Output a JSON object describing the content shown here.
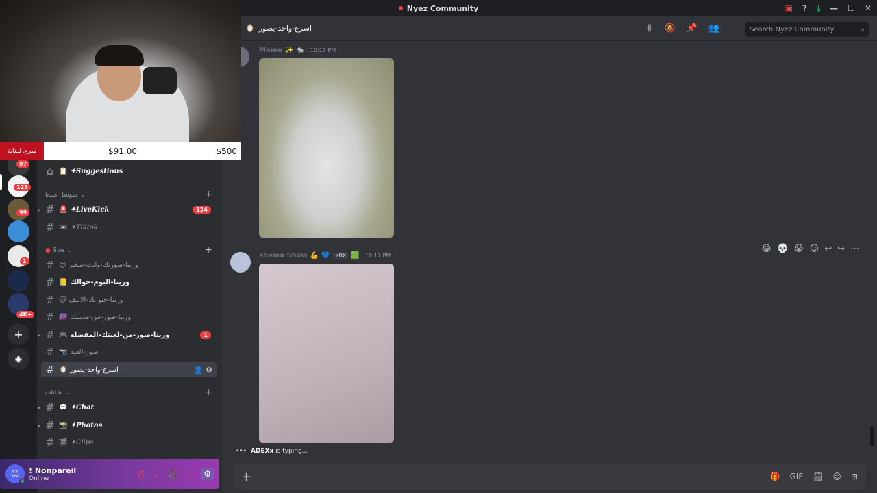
{
  "window": {
    "title": "Nyez Community"
  },
  "overlay": {
    "donation_label": "سري للغاية",
    "current": "$91.00",
    "goal": "$500",
    "progress_fraction": 0.182
  },
  "guild_badges": [
    "97",
    "125",
    "99",
    "1",
    "4K+"
  ],
  "header": {
    "channel": "اسرع-واحد-يصور",
    "search_placeholder": "Search Nyez Community"
  },
  "sidebar": {
    "top_channel": "✦Suggestions",
    "categories": [
      {
        "name": "سوشل ميديا",
        "channels": [
          {
            "name": "✦LiveKick",
            "badge": "124"
          },
          {
            "name": "✦Tiktok"
          }
        ]
      },
      {
        "name": "live",
        "channels": [
          {
            "name": "ورينا-صورتك-وانت-صغير"
          },
          {
            "name": "ورينا-البوم-جوالك"
          },
          {
            "name": "ورينا-حيوانك-الاليف"
          },
          {
            "name": "ورينا-صور-من-مدينتك"
          },
          {
            "name": "ورينا-صور-من-لعبتك-المفضله",
            "badge": "1"
          },
          {
            "name": "صور-العيد"
          },
          {
            "name": "اسرع-واحد-يصور"
          }
        ]
      },
      {
        "name": "شاتات",
        "channels": [
          {
            "name": "✦Chat"
          },
          {
            "name": "✦Photos"
          },
          {
            "name": "✦Clips"
          }
        ]
      }
    ]
  },
  "messages": [
    {
      "author": "Meme",
      "time": "10:17 PM"
    },
    {
      "author": "shama Show",
      "tag": "BX",
      "time": "10:17 PM"
    }
  ],
  "typing": {
    "user": "ADEXx",
    "text": "is typing..."
  },
  "user": {
    "name": "! Nonpareil",
    "status": "Online"
  }
}
